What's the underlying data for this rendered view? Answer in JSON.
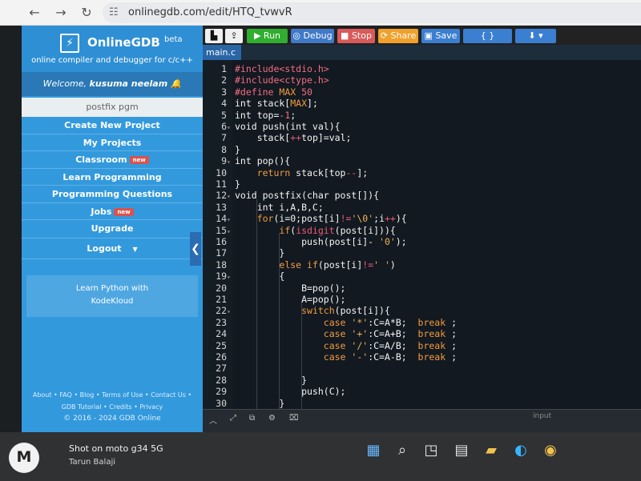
{
  "browser": {
    "url": "onlinegdb.com/edit/HTQ_tvwvR",
    "back_icon": "arrow-left",
    "forward_icon": "arrow-right",
    "reload_icon": "reload",
    "tune_icon": "site-settings"
  },
  "sidebar": {
    "brand_name": "OnlineGDB",
    "brand_beta": "beta",
    "brand_subtitle": "online compiler and debugger for c/c++",
    "welcome_prefix": "Welcome,",
    "welcome_user": "kusuma neelam",
    "project_name": "postfix pgm",
    "menu": [
      {
        "label": "Create New Project"
      },
      {
        "label": "My Projects"
      },
      {
        "label": "Classroom",
        "badge": "new"
      },
      {
        "label": "Learn Programming"
      },
      {
        "label": "Programming Questions"
      },
      {
        "label": "Jobs",
        "badge": "new"
      },
      {
        "label": "Upgrade"
      },
      {
        "label": "Logout"
      }
    ],
    "ad_line1": "Learn Python with",
    "ad_line2": "KodeKloud",
    "footer_links": "About • FAQ • Blog • Terms of Use • Contact Us •",
    "footer_links2": "GDB Tutorial • Credits • Privacy",
    "footer_copy": "© 2016 - 2024 GDB Online"
  },
  "toolbar": {
    "run": "▶ Run",
    "debug": "Debug",
    "stop": "Stop",
    "share": "Share",
    "save": "Save",
    "beautify": "{ } Beautify",
    "download_label": "⬇ ▾"
  },
  "editor": {
    "file_tab": "main.c",
    "lines": [
      {
        "num": "1",
        "fold": "",
        "text": "#include<stdio.h>"
      },
      {
        "num": "2",
        "fold": "",
        "text": "#include<ctype.h>"
      },
      {
        "num": "3",
        "fold": "",
        "text": "#define MAX 50"
      },
      {
        "num": "4",
        "fold": "",
        "text": "int stack[MAX];"
      },
      {
        "num": "5",
        "fold": "",
        "text": "int top=-1;"
      },
      {
        "num": "6",
        "fold": "▾",
        "text": "void push(int val){"
      },
      {
        "num": "7",
        "fold": "",
        "text": "    stack[++top]=val;"
      },
      {
        "num": "8",
        "fold": "",
        "text": "}"
      },
      {
        "num": "9",
        "fold": "▾",
        "text": "int pop(){"
      },
      {
        "num": "10",
        "fold": "",
        "text": "    return stack[top--];"
      },
      {
        "num": "11",
        "fold": "",
        "text": "}"
      },
      {
        "num": "12",
        "fold": "▾",
        "text": "void postfix(char post[]){"
      },
      {
        "num": "13",
        "fold": "",
        "text": "    int i,A,B,C;"
      },
      {
        "num": "14",
        "fold": "▾",
        "text": "    for(i=0;post[i]!='\\0';i++){"
      },
      {
        "num": "15",
        "fold": "▾",
        "text": "        if(isdigit(post[i])){"
      },
      {
        "num": "16",
        "fold": "",
        "text": "            push(post[i]- '0');"
      },
      {
        "num": "17",
        "fold": "",
        "text": "        }"
      },
      {
        "num": "18",
        "fold": "",
        "text": "        else if(post[i]!=' ')"
      },
      {
        "num": "19",
        "fold": "▾",
        "text": "        {"
      },
      {
        "num": "20",
        "fold": "",
        "text": "            B=pop();"
      },
      {
        "num": "21",
        "fold": "",
        "text": "            A=pop();"
      },
      {
        "num": "22",
        "fold": "▾",
        "text": "            switch(post[i]){"
      },
      {
        "num": "23",
        "fold": "",
        "text": "                case '*':C=A*B;  break ;"
      },
      {
        "num": "24",
        "fold": "",
        "text": "                case '+':C=A+B;  break ;"
      },
      {
        "num": "25",
        "fold": "",
        "text": "                case '/':C=A/B;  break ;"
      },
      {
        "num": "26",
        "fold": "",
        "text": "                case '-':C=A-B;  break ;"
      },
      {
        "num": "27",
        "fold": "",
        "text": ""
      },
      {
        "num": "28",
        "fold": "",
        "text": "            }"
      },
      {
        "num": "29",
        "fold": "",
        "text": "            push(C);"
      },
      {
        "num": "30",
        "fold": "",
        "text": "        }"
      }
    ],
    "input_label": "input"
  },
  "taskbar": {
    "shot_on": "Shot on moto g34 5G",
    "photographer": "Tarun Balaji",
    "windows_icon": "windows-start",
    "search_icon": "search",
    "widgets_icon": "widgets",
    "taskview_icon": "task-view",
    "folder_icon": "file-explorer",
    "edge_icon": "edge",
    "chrome_icon": "chrome"
  }
}
